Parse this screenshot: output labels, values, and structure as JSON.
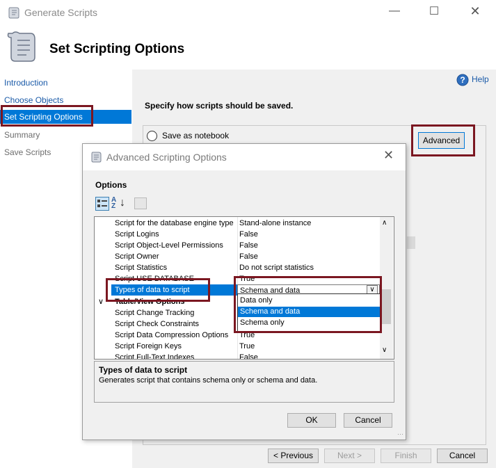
{
  "window": {
    "title": "Generate Scripts"
  },
  "header": {
    "title": "Set Scripting Options"
  },
  "nav": {
    "items": [
      "Introduction",
      "Choose Objects",
      "Set Scripting Options",
      "Summary",
      "Save Scripts"
    ]
  },
  "help": {
    "label": "Help"
  },
  "main": {
    "instruction": "Specify how scripts should be saved.",
    "save_notebook_label": "Save as notebook",
    "advanced_label": "Advanced"
  },
  "dialog": {
    "title": "Advanced Scripting Options",
    "options_label": "Options",
    "rows": [
      {
        "name": "Script for the database engine type",
        "value": "Stand-alone instance"
      },
      {
        "name": "Script Logins",
        "value": "False"
      },
      {
        "name": "Script Object-Level Permissions",
        "value": "False"
      },
      {
        "name": "Script Owner",
        "value": "False"
      },
      {
        "name": "Script Statistics",
        "value": "Do not script statistics"
      },
      {
        "name": "Script USE DATABASE",
        "value": "True"
      }
    ],
    "selected_row": {
      "name": "Types of data to script",
      "value": "Schema and data"
    },
    "section": "Table/View Options",
    "section_rows": [
      {
        "name": "Script Change Tracking",
        "value": ""
      },
      {
        "name": "Script Check Constraints",
        "value": ""
      },
      {
        "name": "Script Data Compression Options",
        "value": "True"
      },
      {
        "name": "Script Foreign Keys",
        "value": "True"
      },
      {
        "name": "Script Full-Text Indexes",
        "value": "False"
      }
    ],
    "dropdown_options": [
      "Data only",
      "Schema and data",
      "Schema only"
    ],
    "description_title": "Types of data to script",
    "description_text": "Generates script that contains schema only or schema and data.",
    "ok_label": "OK",
    "cancel_label": "Cancel"
  },
  "footer": {
    "previous_label": "< Previous",
    "next_label": "Next >",
    "finish_label": "Finish",
    "cancel_label": "Cancel"
  },
  "colors": {
    "accent": "#0078d7",
    "highlight_border": "#7b1721"
  }
}
